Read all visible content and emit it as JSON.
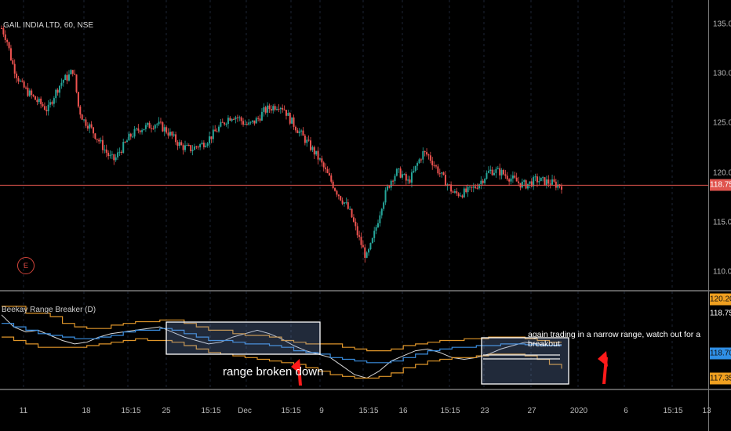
{
  "title": "GAIL INDIA LTD, 60, NSE",
  "indicator_title": "Beekay Range Breaker (D)",
  "event_badge": "E",
  "annotations": {
    "range_broken": "range broken down",
    "narrow_range": "again trading in a narrow range, watch out for a breakout"
  },
  "price_axis": {
    "ticks": [
      "135.00",
      "130.00",
      "125.00",
      "120.00",
      "115.00",
      "110.00"
    ],
    "current_price": "118.75",
    "current_color": "#e0544e"
  },
  "indicator_axis": {
    "tags": [
      {
        "label": "120.20",
        "color": "#f0a020"
      },
      {
        "label": "118.75",
        "color": "#000000",
        "text_color": "#ffffff"
      },
      {
        "label": "118.70",
        "color": "#2f8fe6"
      },
      {
        "label": "117.35",
        "color": "#f0a020"
      }
    ]
  },
  "time_axis": [
    "11",
    "18",
    "15:15",
    "25",
    "15:15",
    "Dec",
    "15:15",
    "9",
    "15:15",
    "16",
    "15:15",
    "23",
    "27",
    "2020",
    "6",
    "15:15",
    "13"
  ],
  "colors": {
    "up": "#26a69a",
    "down": "#ef5350",
    "price_line": "#e0544e",
    "white_line": "#d8d8d8",
    "blue_line": "#3a8ee0",
    "orange_line": "#e0962a"
  },
  "chart_data": {
    "type": "candlestick",
    "title": "GAIL INDIA LTD, 60, NSE",
    "ylim": [
      109,
      137
    ],
    "close_path": [
      134.6,
      133.5,
      131.2,
      129.8,
      128.8,
      128.2,
      127.7,
      127.2,
      126.8,
      126.3,
      127.6,
      128.6,
      129.4,
      129.7,
      130.5,
      126.5,
      125.3,
      124.8,
      124.0,
      123.2,
      122.4,
      121.6,
      121.3,
      122.2,
      122.9,
      123.7,
      124.1,
      124.5,
      124.6,
      124.8,
      125.0,
      124.7,
      124.3,
      123.8,
      123.2,
      122.7,
      122.5,
      122.4,
      122.7,
      122.9,
      123.3,
      123.8,
      124.4,
      124.9,
      125.5,
      125.8,
      125.6,
      125.1,
      124.8,
      125.1,
      125.5,
      126.2,
      126.5,
      126.7,
      126.9,
      126.5,
      125.5,
      124.8,
      124.1,
      123.4,
      122.7,
      122.0,
      121.2,
      120.2,
      119.3,
      118.3,
      117.5,
      116.8,
      115.8,
      114.2,
      112.8,
      111.4,
      112.8,
      114.7,
      116.8,
      118.3,
      119.5,
      120.1,
      119.8,
      119.0,
      119.8,
      121.0,
      122.0,
      121.8,
      121.0,
      120.2,
      119.4,
      118.7,
      117.9,
      117.9,
      118.0,
      118.2,
      118.5,
      119.0,
      119.6,
      120.2,
      120.2,
      120.1,
      119.8,
      119.5,
      119.2,
      118.9,
      118.8,
      119.0,
      119.3,
      119.2,
      119.1,
      119.0,
      118.8,
      118.75
    ],
    "x_ticks": [
      "11",
      "18",
      "15:15",
      "25",
      "15:15",
      "Dec",
      "15:15",
      "9",
      "15:15",
      "16",
      "15:15",
      "23",
      "27",
      "2020",
      "6",
      "15:15",
      "13"
    ],
    "y_ticks": [
      135,
      130,
      125,
      120,
      115,
      110
    ],
    "current_price": 118.75,
    "indicator": {
      "name": "Beekay Range Breaker (D)",
      "ylim": [
        116.5,
        121.5
      ],
      "series": [
        {
          "name": "close",
          "color": "#d8d8d8",
          "values": [
            120.5,
            119.8,
            119.5,
            119.6,
            119.3,
            119.0,
            118.8,
            118.9,
            119.2,
            119.4,
            119.5,
            119.6,
            119.7,
            119.8,
            119.5,
            119.2,
            119.0,
            118.8,
            118.9,
            119.2,
            119.4,
            119.6,
            119.4,
            119.1,
            118.7,
            118.4,
            118.2,
            118.0,
            117.5,
            117.0,
            116.8,
            117.2,
            117.8,
            118.1,
            118.4,
            118.5,
            118.3,
            118.0,
            117.9,
            118.0,
            118.2,
            118.5,
            118.7,
            118.9,
            118.8,
            118.7,
            118.75
          ]
        },
        {
          "name": "upper",
          "color": "#e0962a",
          "values": [
            121.0,
            121.0,
            120.6,
            120.6,
            120.4,
            120.0,
            119.8,
            119.7,
            119.7,
            119.9,
            120.0,
            120.1,
            120.1,
            120.2,
            120.2,
            120.0,
            119.8,
            119.6,
            119.6,
            119.4,
            119.3,
            119.3,
            119.2,
            119.0,
            118.9,
            118.8,
            118.8,
            118.8,
            118.6,
            118.5,
            118.4,
            118.4,
            118.5,
            118.7,
            118.8,
            118.9,
            119.0,
            119.0,
            119.1,
            119.1,
            119.2,
            119.2,
            119.2,
            119.1,
            119.0,
            118.9,
            118.9
          ]
        },
        {
          "name": "middle",
          "color": "#3a8ee0",
          "values": [
            120.0,
            119.8,
            119.6,
            119.4,
            119.3,
            119.2,
            119.1,
            119.1,
            119.2,
            119.3,
            119.5,
            119.6,
            119.6,
            119.7,
            119.6,
            119.4,
            119.2,
            119.0,
            119.0,
            118.9,
            118.8,
            118.8,
            118.7,
            118.6,
            118.4,
            118.3,
            118.2,
            118.0,
            117.9,
            117.8,
            117.7,
            117.7,
            117.8,
            118.0,
            118.2,
            118.4,
            118.5,
            118.6,
            118.6,
            118.7,
            118.7,
            118.8,
            118.8,
            118.75,
            118.7,
            118.7,
            118.7
          ]
        },
        {
          "name": "lower",
          "color": "#e0962a",
          "values": [
            119.2,
            119.0,
            118.8,
            118.6,
            118.6,
            118.6,
            118.6,
            118.7,
            118.8,
            118.9,
            119.0,
            119.1,
            119.0,
            119.0,
            118.9,
            118.7,
            118.5,
            118.3,
            118.2,
            118.1,
            118.0,
            117.9,
            117.8,
            117.7,
            117.6,
            117.4,
            117.2,
            117.0,
            116.9,
            116.8,
            116.8,
            116.9,
            117.1,
            117.4,
            117.6,
            117.8,
            117.9,
            118.0,
            118.0,
            118.1,
            118.2,
            118.2,
            118.2,
            118.1,
            117.9,
            117.6,
            117.35
          ]
        }
      ]
    }
  }
}
